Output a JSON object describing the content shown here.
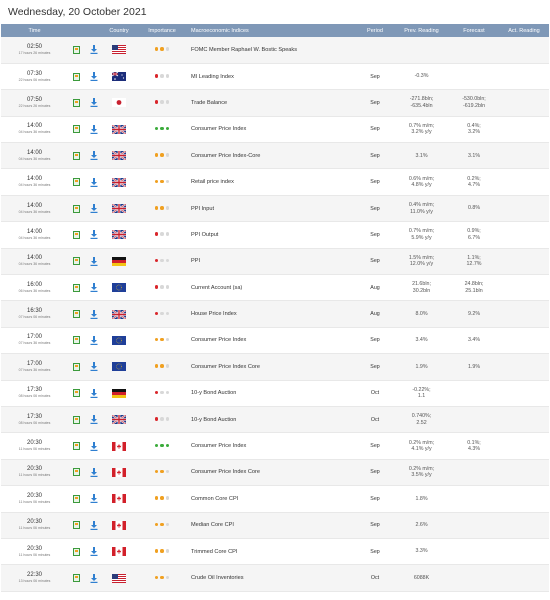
{
  "title": "Wednesday, 20 October 2021",
  "columns": [
    "Time",
    "Country",
    "Importance",
    "Macroeconomic Indices",
    "Period",
    "Prev. Reading",
    "Forecast",
    "Act. Reading"
  ],
  "colors": {
    "header_bg": "#7f98b7",
    "dot_red": "#d9262b",
    "dot_orange": "#f0a020",
    "dot_green": "#3bab3b",
    "dot_empty": "#d8d8d8"
  },
  "rows": [
    {
      "time": "02:50",
      "sub": "17 hours 26 minutes",
      "flag": "us",
      "imp": [
        "orange",
        "orange",
        "empty"
      ],
      "indicator": "FOMC Member Raphael W. Bostic Speaks",
      "period": "",
      "prev": [
        "",
        ""
      ],
      "forecast": [
        "",
        ""
      ],
      "actual": ""
    },
    {
      "time": "07:30",
      "sub": "22 hours 06 minutes",
      "flag": "au",
      "imp": [
        "red",
        "empty",
        "empty"
      ],
      "indicator": "MI Leading Index",
      "period": "Sep",
      "prev": [
        "-0.3%",
        ""
      ],
      "forecast": [
        "",
        ""
      ],
      "actual": ""
    },
    {
      "time": "07:50",
      "sub": "22 hours 26 minutes",
      "flag": "jp",
      "imp": [
        "red",
        "empty",
        "empty"
      ],
      "indicator": "Trade Balance",
      "period": "Sep",
      "prev": [
        "-271.8bln;",
        "-635.4bln"
      ],
      "forecast": [
        "-530.0bln;",
        "-619.2bln"
      ],
      "actual": ""
    },
    {
      "time": "14:00",
      "sub": "04 hours 36 minutes",
      "flag": "gb",
      "imp": [
        "green",
        "green",
        "green"
      ],
      "indicator": "Consumer Price Index",
      "period": "Sep",
      "prev": [
        "0.7% m/m;",
        "3.2% y/y"
      ],
      "forecast": [
        "0.4%;",
        "3.2%"
      ],
      "actual": ""
    },
    {
      "time": "14:00",
      "sub": "04 hours 36 minutes",
      "flag": "gb",
      "imp": [
        "orange",
        "orange",
        "empty"
      ],
      "indicator": "Consumer Price Index-Core",
      "period": "Sep",
      "prev": [
        "3.1%",
        ""
      ],
      "forecast": [
        "3.1%",
        ""
      ],
      "actual": ""
    },
    {
      "time": "14:00",
      "sub": "04 hours 36 minutes",
      "flag": "gb",
      "imp": [
        "orange",
        "orange",
        "empty"
      ],
      "indicator": "Retail price index",
      "period": "Sep",
      "prev": [
        "0.6% m/m;",
        "4.8% y/y"
      ],
      "forecast": [
        "0.2%;",
        "4.7%"
      ],
      "actual": ""
    },
    {
      "time": "14:00",
      "sub": "04 hours 36 minutes",
      "flag": "gb",
      "imp": [
        "orange",
        "orange",
        "empty"
      ],
      "indicator": "PPI Input",
      "period": "Sep",
      "prev": [
        "0.4% m/m;",
        "11.0% y/y"
      ],
      "forecast": [
        "0.8%",
        ""
      ],
      "actual": ""
    },
    {
      "time": "14:00",
      "sub": "04 hours 36 minutes",
      "flag": "gb",
      "imp": [
        "red",
        "empty",
        "empty"
      ],
      "indicator": "PPI Output",
      "period": "Sep",
      "prev": [
        "0.7% m/m;",
        "5.9% y/y"
      ],
      "forecast": [
        "0.9%;",
        "6.7%"
      ],
      "actual": ""
    },
    {
      "time": "14:00",
      "sub": "04 hours 36 minutes",
      "flag": "de",
      "imp": [
        "red",
        "empty",
        "empty"
      ],
      "indicator": "PPI",
      "period": "Sep",
      "prev": [
        "1.5% m/m;",
        "12.0% y/y"
      ],
      "forecast": [
        "1.1%;",
        "12.7%"
      ],
      "actual": ""
    },
    {
      "time": "16:00",
      "sub": "06 hours 36 minutes",
      "flag": "eu",
      "imp": [
        "red",
        "empty",
        "empty"
      ],
      "indicator": "Current Account (sa)",
      "period": "Aug",
      "prev": [
        "21.6bln;",
        "30.2bln"
      ],
      "forecast": [
        "24.8bln;",
        "25.1bln"
      ],
      "actual": ""
    },
    {
      "time": "16:30",
      "sub": "07 hours 06 minutes",
      "flag": "gb",
      "imp": [
        "red",
        "empty",
        "empty"
      ],
      "indicator": "House Price Index",
      "period": "Aug",
      "prev": [
        "8.0%",
        ""
      ],
      "forecast": [
        "9.2%",
        ""
      ],
      "actual": ""
    },
    {
      "time": "17:00",
      "sub": "07 hours 36 minutes",
      "flag": "eu",
      "imp": [
        "orange",
        "orange",
        "empty"
      ],
      "indicator": "Consumer Price Index",
      "period": "Sep",
      "prev": [
        "3.4%",
        ""
      ],
      "forecast": [
        "3.4%",
        ""
      ],
      "actual": ""
    },
    {
      "time": "17:00",
      "sub": "07 hours 36 minutes",
      "flag": "eu",
      "imp": [
        "orange",
        "orange",
        "empty"
      ],
      "indicator": "Consumer Price Index Core",
      "period": "Sep",
      "prev": [
        "1.9%",
        ""
      ],
      "forecast": [
        "1.9%",
        ""
      ],
      "actual": ""
    },
    {
      "time": "17:30",
      "sub": "08 hours 06 minutes",
      "flag": "de",
      "imp": [
        "red",
        "empty",
        "empty"
      ],
      "indicator": "10-y Bond Auction",
      "period": "Oct",
      "prev": [
        "-0.22%;",
        "1.1"
      ],
      "forecast": [
        "",
        ""
      ],
      "actual": ""
    },
    {
      "time": "17:30",
      "sub": "08 hours 06 minutes",
      "flag": "gb",
      "imp": [
        "red",
        "empty",
        "empty"
      ],
      "indicator": "10-y Bond Auction",
      "period": "Oct",
      "prev": [
        "0.740%;",
        "2.52"
      ],
      "forecast": [
        "",
        ""
      ],
      "actual": ""
    },
    {
      "time": "20:30",
      "sub": "11 hours 06 minutes",
      "flag": "ca",
      "imp": [
        "green",
        "green",
        "green"
      ],
      "indicator": "Consumer Price Index",
      "period": "Sep",
      "prev": [
        "0.2% m/m;",
        "4.1% y/y"
      ],
      "forecast": [
        "0.1%;",
        "4.3%"
      ],
      "actual": ""
    },
    {
      "time": "20:30",
      "sub": "11 hours 06 minutes",
      "flag": "ca",
      "imp": [
        "orange",
        "orange",
        "empty"
      ],
      "indicator": "Consumer Price Index Core",
      "period": "Sep",
      "prev": [
        "0.2% m/m;",
        "3.5% y/y"
      ],
      "forecast": [
        "",
        ""
      ],
      "actual": ""
    },
    {
      "time": "20:30",
      "sub": "11 hours 06 minutes",
      "flag": "ca",
      "imp": [
        "orange",
        "orange",
        "empty"
      ],
      "indicator": "Common Core CPI",
      "period": "Sep",
      "prev": [
        "1.8%",
        ""
      ],
      "forecast": [
        "",
        ""
      ],
      "actual": ""
    },
    {
      "time": "20:30",
      "sub": "11 hours 06 minutes",
      "flag": "ca",
      "imp": [
        "orange",
        "orange",
        "empty"
      ],
      "indicator": "Median Core CPI",
      "period": "Sep",
      "prev": [
        "2.6%",
        ""
      ],
      "forecast": [
        "",
        ""
      ],
      "actual": ""
    },
    {
      "time": "20:30",
      "sub": "11 hours 06 minutes",
      "flag": "ca",
      "imp": [
        "orange",
        "orange",
        "empty"
      ],
      "indicator": "Trimmed Core CPI",
      "period": "Sep",
      "prev": [
        "3.3%",
        ""
      ],
      "forecast": [
        "",
        ""
      ],
      "actual": ""
    },
    {
      "time": "22:30",
      "sub": "13 hours 06 minutes",
      "flag": "us",
      "imp": [
        "orange",
        "orange",
        "empty"
      ],
      "indicator": "Crude Oil Inventories",
      "period": "Oct",
      "prev": [
        "6088K",
        ""
      ],
      "forecast": [
        "",
        ""
      ],
      "actual": ""
    }
  ]
}
